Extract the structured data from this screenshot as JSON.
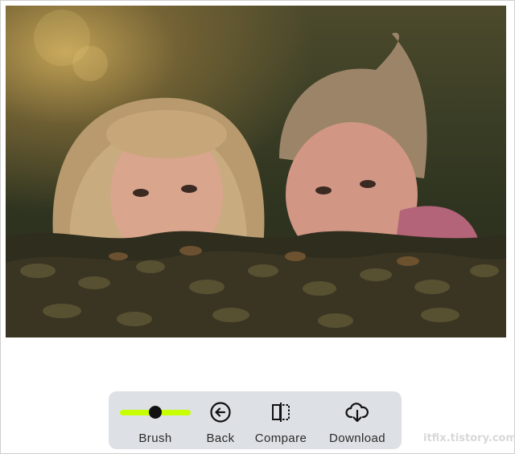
{
  "toolbar": {
    "brush": {
      "label": "Brush",
      "level": 0.5
    },
    "back": {
      "label": "Back",
      "icon": "arrow-left-circle-icon"
    },
    "compare": {
      "label": "Compare",
      "icon": "split-compare-icon"
    },
    "download": {
      "label": "Download",
      "icon": "cloud-download-icon"
    }
  },
  "watermark": "itfix.tistory.com",
  "colors": {
    "toolbar_bg": "#dde0e4",
    "slider_track": "#c8ff00",
    "slider_thumb": "#111111"
  }
}
